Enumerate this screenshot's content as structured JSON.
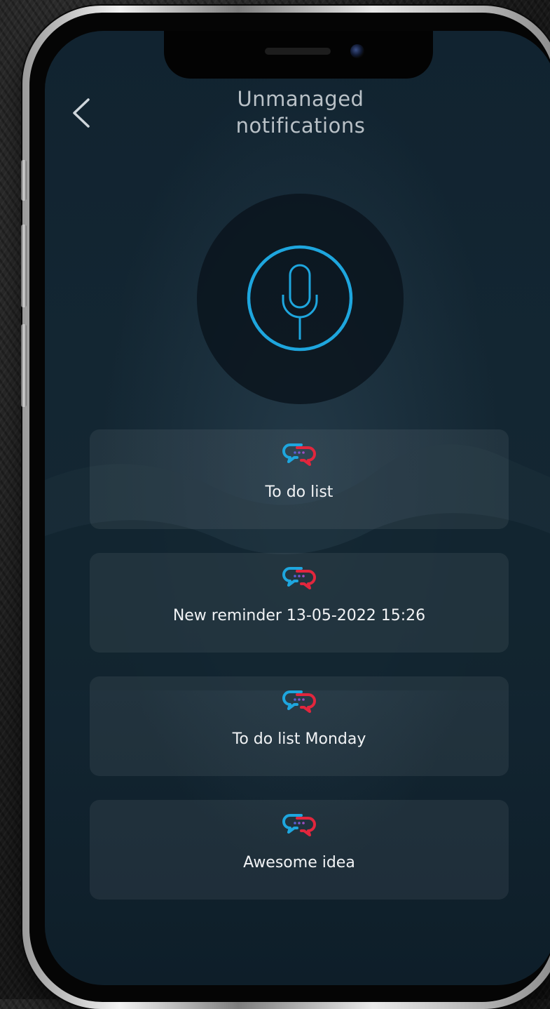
{
  "header": {
    "title_line1": "Unmanaged",
    "title_line2": "notifications"
  },
  "icons": {
    "back": "chevron-left-icon",
    "microphone": "microphone-icon",
    "notification": "chat-bubble-icon"
  },
  "colors": {
    "accent": "#1ea6de",
    "accent_secondary": "#e2263d",
    "background": "#132632",
    "card": "#1f3039",
    "text": "#f1f3f5"
  },
  "notifications": [
    {
      "label": "To do list"
    },
    {
      "label": "New reminder 13-05-2022 15:26"
    },
    {
      "label": "To do list Monday"
    },
    {
      "label": "Awesome idea"
    }
  ]
}
